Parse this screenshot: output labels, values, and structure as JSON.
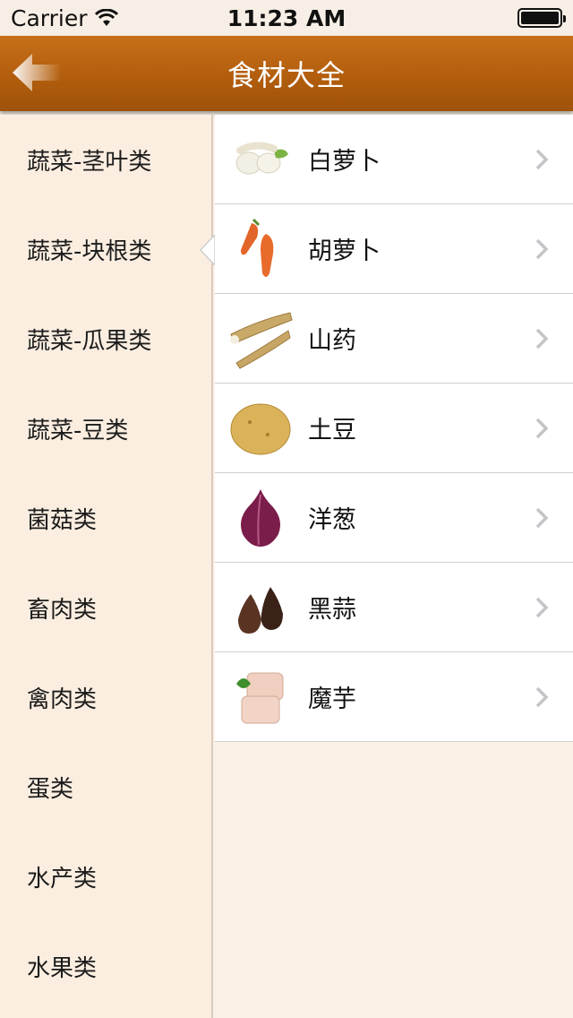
{
  "status_bar": {
    "carrier": "Carrier",
    "time": "11:23 AM"
  },
  "nav": {
    "title": "食材大全"
  },
  "sidebar": {
    "items": [
      {
        "label": "蔬菜-茎叶类"
      },
      {
        "label": "蔬菜-块根类"
      },
      {
        "label": "蔬菜-瓜果类"
      },
      {
        "label": "蔬菜-豆类"
      },
      {
        "label": "菌菇类"
      },
      {
        "label": "畜肉类"
      },
      {
        "label": "禽肉类"
      },
      {
        "label": "蛋类"
      },
      {
        "label": "水产类"
      },
      {
        "label": "水果类"
      }
    ],
    "selected_index": 1
  },
  "list": {
    "items": [
      {
        "label": "白萝卜",
        "icon": "white-radish-thumbnail"
      },
      {
        "label": "胡萝卜",
        "icon": "carrot-thumbnail"
      },
      {
        "label": "山药",
        "icon": "yam-thumbnail"
      },
      {
        "label": "土豆",
        "icon": "potato-thumbnail"
      },
      {
        "label": "洋葱",
        "icon": "onion-thumbnail"
      },
      {
        "label": "黑蒜",
        "icon": "black-garlic-thumbnail"
      },
      {
        "label": "魔芋",
        "icon": "konjac-thumbnail"
      }
    ]
  },
  "colors": {
    "nav_bar": "#b05c0c",
    "sidebar_bg": "#fbeee0",
    "chevron": "#c7c7cc"
  }
}
